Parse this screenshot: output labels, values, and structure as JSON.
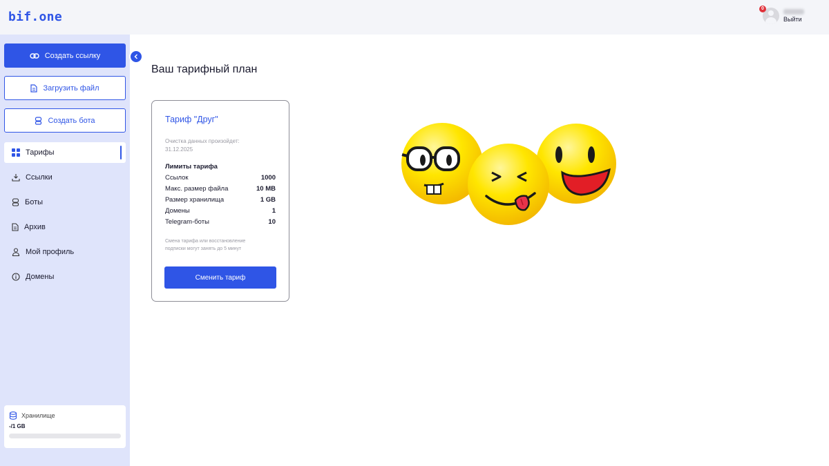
{
  "app": {
    "logo": "bif.one"
  },
  "user": {
    "notifications": "0",
    "logout_label": "Выйти"
  },
  "sidebar": {
    "create_link_label": "Создать ссылку",
    "upload_file_label": "Загрузить файл",
    "create_bot_label": "Создать бота",
    "items": [
      {
        "label": "Тарифы",
        "icon": "grid-icon",
        "active": true
      },
      {
        "label": "Ссылки",
        "icon": "download-icon"
      },
      {
        "label": "Боты",
        "icon": "bot-icon"
      },
      {
        "label": "Архив",
        "icon": "document-icon"
      },
      {
        "label": "Мой профиль",
        "icon": "user-icon"
      },
      {
        "label": "Домены",
        "icon": "info-icon"
      }
    ],
    "storage": {
      "label": "Хранилище",
      "value": "-/1 GB",
      "used_fraction": 0
    }
  },
  "main": {
    "title": "Ваш тарифный план",
    "plan": {
      "name": "Тариф \"Друг\"",
      "clear_label": "Очистка данных произойдет:",
      "clear_date": "31.12.2025",
      "limits_title": "Лимиты тарифа",
      "limits": [
        {
          "label": "Ссылок",
          "value": "1000"
        },
        {
          "label": "Макс. размер файла",
          "value": "10 MB"
        },
        {
          "label": "Размер хранилища",
          "value": "1 GB"
        },
        {
          "label": "Домены",
          "value": "1"
        },
        {
          "label": "Telegram-боты",
          "value": "10"
        }
      ],
      "note_line1": "Смена тарифа или восстановление",
      "note_line2": "подписки могут занять до 5 минут",
      "change_button_label": "Сменить тариф"
    }
  },
  "colors": {
    "accent": "#2f55e6",
    "sidebar_bg": "#dfe4fb",
    "emoji_yellow": "#ffe100"
  }
}
